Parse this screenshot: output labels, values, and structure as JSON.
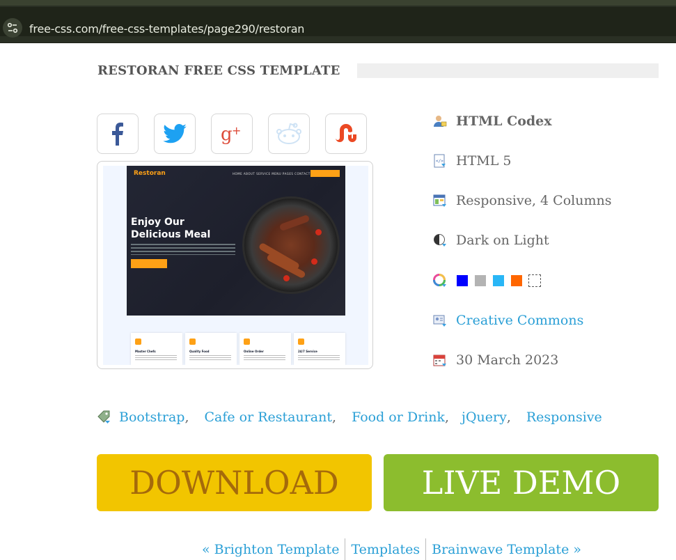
{
  "browser": {
    "url": "free-css.com/free-css-templates/page290/restoran"
  },
  "page": {
    "title": "RESTORAN FREE CSS TEMPLATE"
  },
  "share": [
    {
      "name": "facebook-icon",
      "glyph": "f",
      "color": "#3b5998"
    },
    {
      "name": "twitter-icon",
      "glyph": "",
      "color": "#1da1f2"
    },
    {
      "name": "google-plus-icon",
      "glyph": "g+",
      "color": "#dd4b39"
    },
    {
      "name": "reddit-icon",
      "glyph": "",
      "color": "#cfe3f5"
    },
    {
      "name": "stumbleupon-icon",
      "glyph": "",
      "color": "#eb4924"
    }
  ],
  "preview": {
    "logo": "Restoran",
    "nav": "HOME  ABOUT  SERVICE  MENU  PAGES  CONTACT",
    "headline": "Enjoy Our Delicious Meal",
    "services": [
      "Master Chefs",
      "Quality Food",
      "Online Order",
      "24/7 Service"
    ]
  },
  "info": {
    "author": "HTML Codex",
    "html_version": "HTML 5",
    "layout": "Responsive, 4 Columns",
    "scheme": "Dark on Light",
    "colors": [
      "#0000ff",
      "#b3b3b3",
      "#29b6f6",
      "#ff6600",
      "#ffffff"
    ],
    "license": "Creative Commons",
    "date": "30 March 2023"
  },
  "tags": [
    "Bootstrap",
    "Cafe or Restaurant",
    "Food or Drink",
    "jQuery",
    "Responsive"
  ],
  "buttons": {
    "download": "DOWNLOAD",
    "live_demo": "LIVE DEMO"
  },
  "pager": {
    "prev": "« Brighton Template",
    "index": "Templates",
    "next": "Brainwave Template »"
  }
}
